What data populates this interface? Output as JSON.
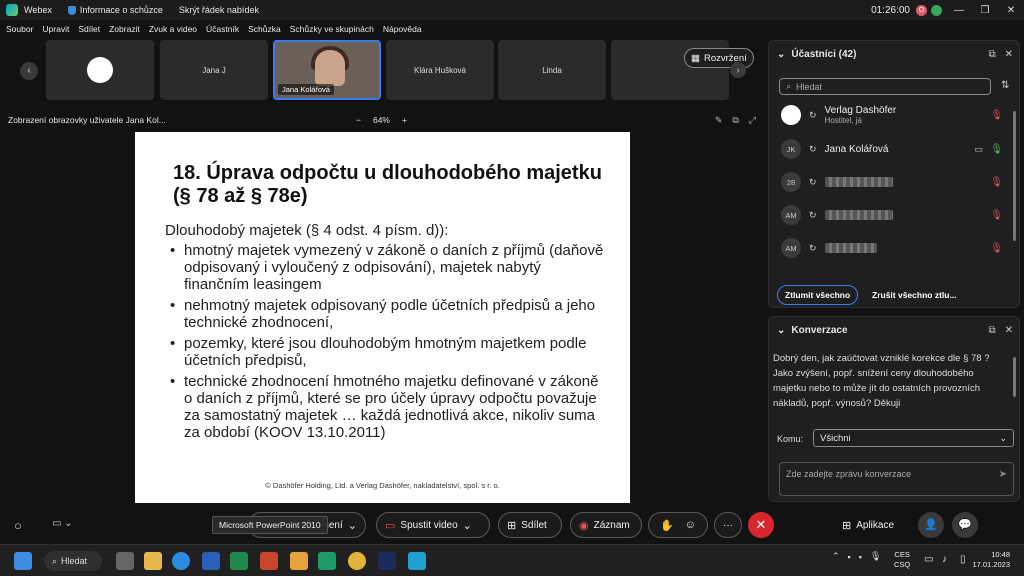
{
  "titlebar": {
    "app": "Webex",
    "info": "Informace o schůzce",
    "hide_menu": "Skrýt řádek nabídek",
    "clock": "01:26:00",
    "avatar_initials": "O"
  },
  "menu": [
    "Soubor",
    "Upravit",
    "Sdílet",
    "Zobrazit",
    "Zvuk a video",
    "Účastník",
    "Schůzka",
    "Schůzky ve skupinách",
    "Nápověda"
  ],
  "thumbs": [
    {
      "label": ""
    },
    {
      "label": "Jana J"
    },
    {
      "label": "Jana Kolářová"
    },
    {
      "label": "Klára Hušková"
    },
    {
      "label": "Linda"
    },
    {
      "label": ""
    }
  ],
  "layout_label": "Rozvržení",
  "share": {
    "title": "Zobrazení obrazovky uživatele Jana Kol...",
    "zoom": "64%",
    "zoom_minus": "−",
    "zoom_plus": "+"
  },
  "slide": {
    "title": "18. Úprava odpočtu u dlouhodobého majetku (§ 78 až § 78e)",
    "lead": "Dlouhodobý majetek (§ 4 odst. 4 písm. d)):",
    "bullets": [
      "hmotný majetek vymezený v zákoně o daních z příjmů (daňově odpisovaný i vyloučený z odpisování), majetek nabytý finančním leasingem",
      "nehmotný majetek odpisovaný podle účetních předpisů a jeho technické zhodnocení,",
      "pozemky, které jsou dlouhodobým hmotným majetkem podle účetních předpisů,",
      "technické zhodnocení hmotného majetku definované v zákoně o daních z příjmů, které se pro účely úpravy odpočtu považuje za samostatný majetek … každá jednotlivá akce, nikoliv suma za období (KOOV 13.10.2011)"
    ],
    "footer": "© Dashöfer Holding, Ltd. a Verlag Dashöfer, nakladatelství, spol. s r. o."
  },
  "controls": {
    "tooltip": "Microsoft PowerPoint 2010",
    "mute": "Ztlumení",
    "video": "Spustit video",
    "share": "Sdílet",
    "record": "Záznam",
    "apps": "Aplikace"
  },
  "participants": {
    "title": "Účastníci (42)",
    "search_placeholder": "Hledat",
    "list": [
      {
        "avatar": "",
        "name": "Verlag Dashöfer",
        "sub": "Hostitel, já"
      },
      {
        "avatar": "JK",
        "name": "Jana Kolářová",
        "sub": ""
      },
      {
        "avatar": "28",
        "name": "",
        "sub": ""
      },
      {
        "avatar": "AM",
        "name": "",
        "sub": ""
      },
      {
        "avatar": "AM",
        "name": "",
        "sub": ""
      }
    ],
    "mute_all": "Ztlumit všechno",
    "unmute_all": "Zrušit všechno ztlu..."
  },
  "chat": {
    "title": "Konverzace",
    "message": "Dobrý den, jak zaúčtovat vzniklé korekce dle § 78 ? Jako zvýšení, popř. snížení ceny dlouhodobého majetku nebo to může jít do ostatních provozních nákladů, popř. výnosů? Děkuji",
    "to_label": "Komu:",
    "to_value": "Všichni",
    "input_placeholder": "Zde zadejte zprávu konverzace"
  },
  "taskbar": {
    "search": "Hledat",
    "lang1": "CES",
    "lang2": "CSQ",
    "time": "10:48",
    "date": "17.01.2023"
  },
  "colors": {
    "accent": "#3c7cf1",
    "leave": "#d7262e",
    "muted": "#e0565b",
    "unmuted": "#4cbe6a"
  }
}
